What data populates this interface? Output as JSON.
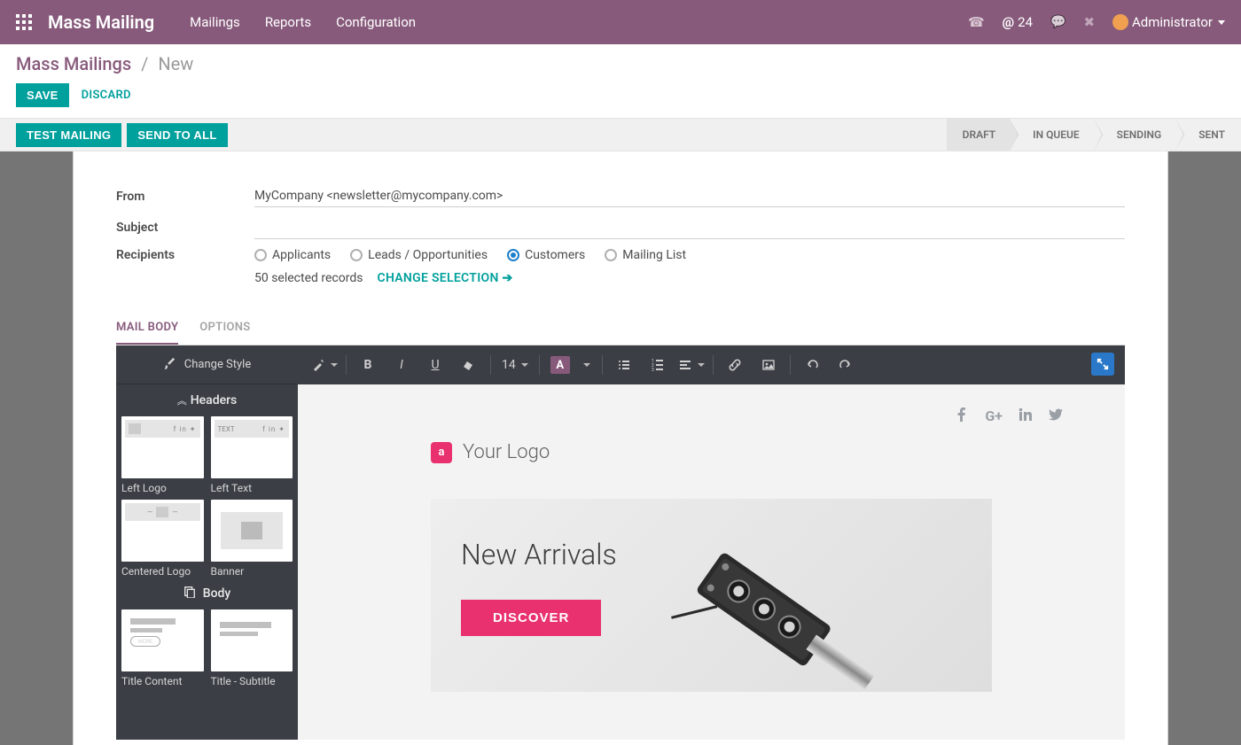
{
  "topbar": {
    "app_title": "Mass Mailing",
    "menu": [
      "Mailings",
      "Reports",
      "Configuration"
    ],
    "mention_count": "24",
    "user_name": "Administrator"
  },
  "breadcrumb": {
    "root": "Mass Mailings",
    "current": "New"
  },
  "actions": {
    "save": "SAVE",
    "discard": "DISCARD"
  },
  "viewbar": {
    "test": "TEST MAILING",
    "send_all": "SEND TO ALL",
    "stages": [
      "DRAFT",
      "IN QUEUE",
      "SENDING",
      "SENT"
    ],
    "active_stage": 0
  },
  "form": {
    "labels": {
      "from": "From",
      "subject": "Subject",
      "recipients": "Recipients"
    },
    "from_value": "MyCompany <newsletter@mycompany.com>",
    "subject_value": "",
    "recipient_options": [
      "Applicants",
      "Leads / Opportunities",
      "Customers",
      "Mailing List"
    ],
    "recipient_selected": 2,
    "selection_text": "50 selected records",
    "change_selection": "CHANGE SELECTION"
  },
  "tabs": [
    "MAIL BODY",
    "OPTIONS"
  ],
  "editor": {
    "change_style": "Change Style",
    "font_size": "14",
    "side_sections": {
      "headers_title": "Headers",
      "body_title": "Body",
      "headers": [
        "Left Logo",
        "Left Text",
        "Centered Logo",
        "Banner"
      ],
      "body": [
        "Title Content",
        "Title - Subtitle"
      ],
      "left_text_badge": "TEXT",
      "more_badge": "MORE"
    },
    "hero": {
      "logo_text": "Your Logo",
      "logo_letter": "a",
      "title": "New Arrivals",
      "cta": "DISCOVER"
    }
  }
}
